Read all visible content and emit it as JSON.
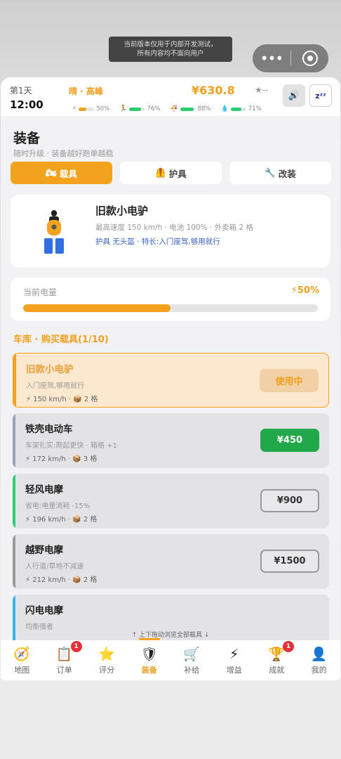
{
  "dev_notice": {
    "line1": "当前版本仅用于内部开发测试，",
    "line2": "所有内容均不面向用户"
  },
  "status": {
    "day": "第1天",
    "time": "12:00",
    "weather": "晴 · 高峰",
    "money": "¥630.8",
    "stars": "★--",
    "meters": [
      {
        "icon": "lightning-icon",
        "symbol": "⚡",
        "value": "50%",
        "fill": 0.5,
        "color": "#f3a21d"
      },
      {
        "icon": "runner-icon",
        "symbol": "🏃",
        "value": "76%",
        "fill": 0.76,
        "color": "#2ecc71"
      },
      {
        "icon": "bowl-icon",
        "symbol": "🍜",
        "value": "88%",
        "fill": 0.88,
        "color": "#2ecc71"
      },
      {
        "icon": "water-drop-icon",
        "symbol": "💧",
        "value": "71%",
        "fill": 0.71,
        "color": "#2ecc71"
      }
    ]
  },
  "page": {
    "title": "装备",
    "subtitle": "随时升级 · 装备越好跑单越稳"
  },
  "tabs": [
    {
      "icon": "🏍",
      "label": "载具",
      "active": true
    },
    {
      "icon": "🦺",
      "label": "护具",
      "active": false
    },
    {
      "icon": "🔧",
      "label": "改装",
      "active": false
    }
  ],
  "current_vehicle": {
    "name": "旧款小电驴",
    "stats": "最高速度 150 km/h · 电池 100% · 外卖箱 2 格",
    "tags": "护具 无头盔 · 特长:入门座驾,够用就行"
  },
  "battery": {
    "label": "当前电量",
    "value": "⚡50%",
    "level": 0.5
  },
  "garage": {
    "title": "车库 · 购买载具(1/10)"
  },
  "vehicles": [
    {
      "name": "旧款小电驴",
      "desc": "入门座驾,够用就行",
      "spec": "⚡ 150 km/h · 📦 2 格",
      "action": "使用中",
      "state": "current",
      "stripe": "#f3a21d"
    },
    {
      "name": "铁壳电动车",
      "desc": "车架扎实:爬起更快 · 箱格 +1",
      "spec": "⚡ 172 km/h · 📦 3 格",
      "action": "¥450",
      "state": "green",
      "stripe": "#9aa3b5"
    },
    {
      "name": "轻风电摩",
      "desc": "省电:电量消耗 -15%",
      "spec": "⚡ 196 km/h · 📦 2 格",
      "action": "¥900",
      "state": "outline",
      "stripe": "#2ecc71"
    },
    {
      "name": "越野电摩",
      "desc": "人行道/草地不减速",
      "spec": "⚡ 212 km/h · 📦 2 格",
      "action": "¥1500",
      "state": "outline",
      "stripe": "#9a9a9a"
    },
    {
      "name": "闪电电摩",
      "desc": "均衡强者",
      "spec": "",
      "action": "",
      "state": "partial",
      "stripe": "#3ab5e6"
    }
  ],
  "scroll_hint": "↑ 上下拖动浏览全部载具 ↓",
  "tabbar": [
    {
      "icon": "compass-icon",
      "symbol": "🧭",
      "label": "地图",
      "badge": ""
    },
    {
      "icon": "clipboard-icon",
      "symbol": "📋",
      "label": "订单",
      "badge": "1"
    },
    {
      "icon": "star-icon",
      "symbol": "⭐",
      "label": "评分",
      "badge": ""
    },
    {
      "icon": "shield-icon",
      "symbol": "🛡",
      "label": "装备",
      "badge": "",
      "active": true
    },
    {
      "icon": "cart-icon",
      "symbol": "🛒",
      "label": "补给",
      "badge": ""
    },
    {
      "icon": "lightning-icon",
      "symbol": "⚡",
      "label": "增益",
      "badge": ""
    },
    {
      "icon": "trophy-icon",
      "symbol": "🏆",
      "label": "成就",
      "badge": "1"
    },
    {
      "icon": "person-icon",
      "symbol": "👤",
      "label": "我的",
      "badge": ""
    }
  ]
}
